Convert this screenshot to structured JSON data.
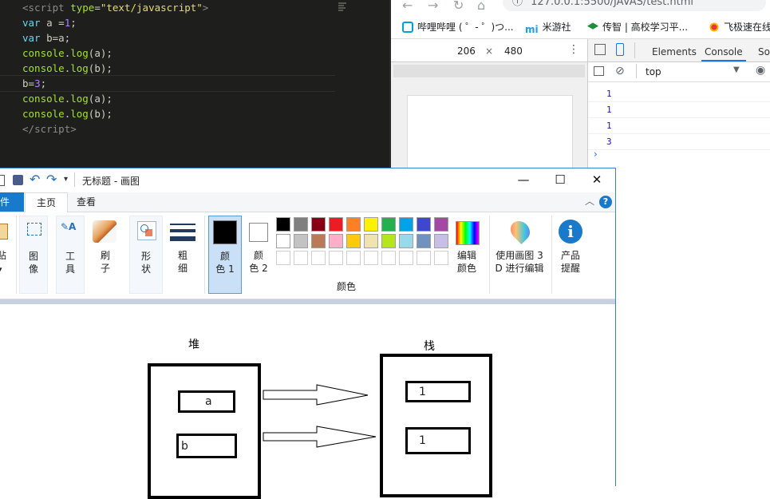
{
  "editor": {
    "lines": [
      {
        "parts": [
          [
            "tag",
            "<"
          ],
          [
            "tag",
            "script "
          ],
          [
            "attr",
            "type"
          ],
          [
            "plain",
            "="
          ],
          [
            "str",
            "\"text/javascript\""
          ],
          [
            "tag",
            ">"
          ]
        ]
      },
      {
        "parts": [
          [
            "kw",
            "var "
          ],
          [
            "plain",
            "a ="
          ],
          [
            "num",
            "1"
          ],
          [
            "plain",
            ";"
          ]
        ]
      },
      {
        "parts": [
          [
            "kw",
            "var "
          ],
          [
            "plain",
            "b=a;"
          ]
        ]
      },
      {
        "parts": [
          [
            "fn",
            "console"
          ],
          [
            "plain",
            "."
          ],
          [
            "fn",
            "log"
          ],
          [
            "plain",
            "(a);"
          ]
        ]
      },
      {
        "parts": [
          [
            "fn",
            "console"
          ],
          [
            "plain",
            "."
          ],
          [
            "fn",
            "log"
          ],
          [
            "plain",
            "(b);"
          ]
        ]
      },
      {
        "parts": [
          [
            "plain",
            "b="
          ],
          [
            "num",
            "3"
          ],
          [
            "plain",
            ";"
          ]
        ]
      },
      {
        "parts": [
          [
            "fn",
            "console"
          ],
          [
            "plain",
            "."
          ],
          [
            "fn",
            "log"
          ],
          [
            "plain",
            "(a);"
          ]
        ]
      },
      {
        "parts": [
          [
            "fn",
            "console"
          ],
          [
            "plain",
            "."
          ],
          [
            "fn",
            "log"
          ],
          [
            "plain",
            "(b);"
          ]
        ]
      },
      {
        "parts": [
          [
            "tag",
            "</"
          ],
          [
            "tag",
            "script"
          ],
          [
            "tag",
            ">"
          ]
        ]
      }
    ]
  },
  "browser": {
    "url": "127.0.0.1:5500/JAVAS/test.html",
    "bookmarks": [
      {
        "label": "哔哩哔哩 ( ゜- ゜)つ...",
        "color": "#00a1d6"
      },
      {
        "label": "米游社",
        "color": "#1f9bf0"
      },
      {
        "label": "传智 | 高校学习平...",
        "color": "#1d8f3c"
      },
      {
        "label": "飞极速在线",
        "color": "#e53935"
      }
    ],
    "device": {
      "width": "206",
      "x": "×",
      "height": "480"
    }
  },
  "devtools": {
    "tabs": [
      "Elements",
      "Console",
      "So"
    ],
    "active_tab": "Console",
    "context": "top",
    "logs": [
      "1",
      "1",
      "1",
      "3"
    ],
    "prompt": "›"
  },
  "paint": {
    "title": "无标题 - 画图",
    "window_buttons": {
      "min": "—",
      "max": "☐",
      "close": "✕"
    },
    "menu": {
      "file": "件",
      "home": "主页",
      "view": "查看"
    },
    "tools": {
      "paste": "贴",
      "image": "图\n像",
      "tools": "工\n具",
      "brush": "刷\n子",
      "shape": "形\n状",
      "size": "粗\n细",
      "color1": "颜\n色 1",
      "color2": "颜\n色 2",
      "edit_colors": "编辑\n颜色",
      "paint3d": "使用画图 3\nD 进行编辑",
      "product": "产品\n提醒"
    },
    "colors_group_label": "颜色",
    "palette": [
      "#000000",
      "#7f7f7f",
      "#880015",
      "#ed1c24",
      "#ff7f27",
      "#fff200",
      "#22b14c",
      "#00a2e8",
      "#3f48cc",
      "#a349a4",
      "#ffffff",
      "#c3c3c3",
      "#b97a57",
      "#ffaec9",
      "#ffc90e",
      "#efe4b0",
      "#b5e61d",
      "#99d9ea",
      "#7092be",
      "#c8bfe7"
    ],
    "drawing": {
      "heap_label": "堆",
      "stack_label": "栈",
      "heap_items": [
        "a",
        "b"
      ],
      "stack_items": [
        "1",
        "1"
      ]
    }
  }
}
